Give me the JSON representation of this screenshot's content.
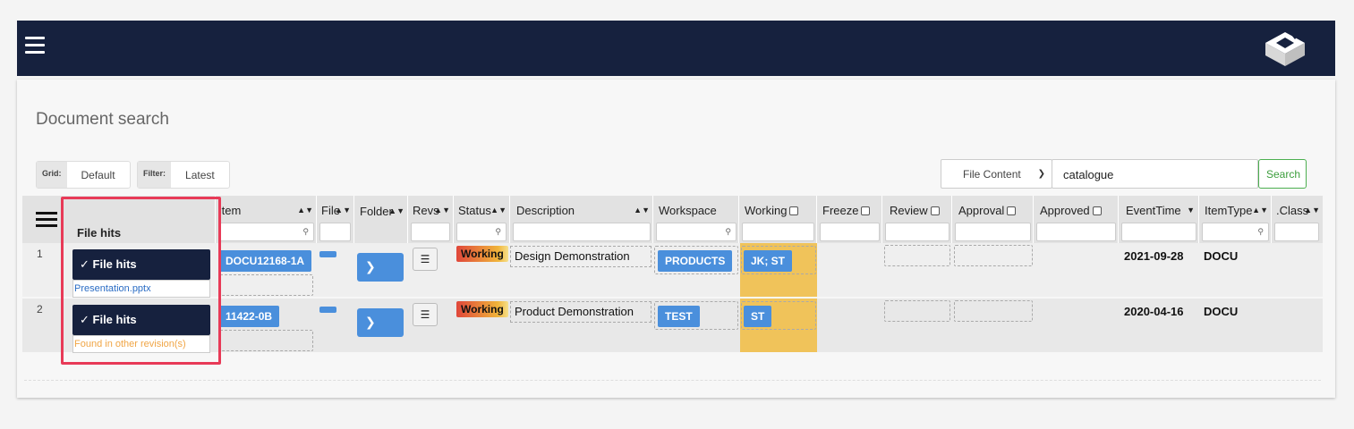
{
  "page": {
    "title": "Document search"
  },
  "toolbar": {
    "grid_label": "Grid:",
    "grid_value": "Default",
    "filter_label": "Filter:",
    "filter_value": "Latest",
    "search_mode": "File Content",
    "search_value": "catalogue",
    "search_button": "Search"
  },
  "columns": {
    "file_hits": "File hits",
    "item": "Item",
    "file": "File",
    "folder": "Folder",
    "revs": "Revs",
    "status": "Status",
    "description": "Description",
    "workspace": "Workspace",
    "working": "Working",
    "freeze": "Freeze",
    "review": "Review",
    "approval": "Approval",
    "approved": "Approved",
    "event_time": "EventTime",
    "item_type": "ItemType",
    "class": ".Class"
  },
  "rows": [
    {
      "num": "1",
      "file_hits_label": "File hits",
      "file_hit_link": "Presentation.pptx",
      "item": "DOCU12168-1A",
      "status": "Working",
      "description": "Design Demonstration",
      "workspace": "PRODUCTS",
      "working": "JK; ST",
      "event_time": "2021-09-28",
      "item_type": "DOCU"
    },
    {
      "num": "2",
      "file_hits_label": "File hits",
      "file_hit_link": "Found in other revision(s)",
      "item": "11422-0B",
      "status": "Working",
      "description": "Product Demonstration",
      "workspace": "TEST",
      "working": "ST",
      "event_time": "2020-04-16",
      "item_type": "DOCU"
    }
  ],
  "icons": [
    "menu-icon",
    "app-logo-icon",
    "grid-menu-icon",
    "sort-icon",
    "magnifier-icon",
    "chevron-down-icon",
    "layers-icon",
    "chevron-right-icon"
  ],
  "colors": {
    "nav": "#16213e",
    "accent_blue": "#4a8fdc",
    "working_col": "#f0c35a",
    "highlight": "#e83a57"
  }
}
